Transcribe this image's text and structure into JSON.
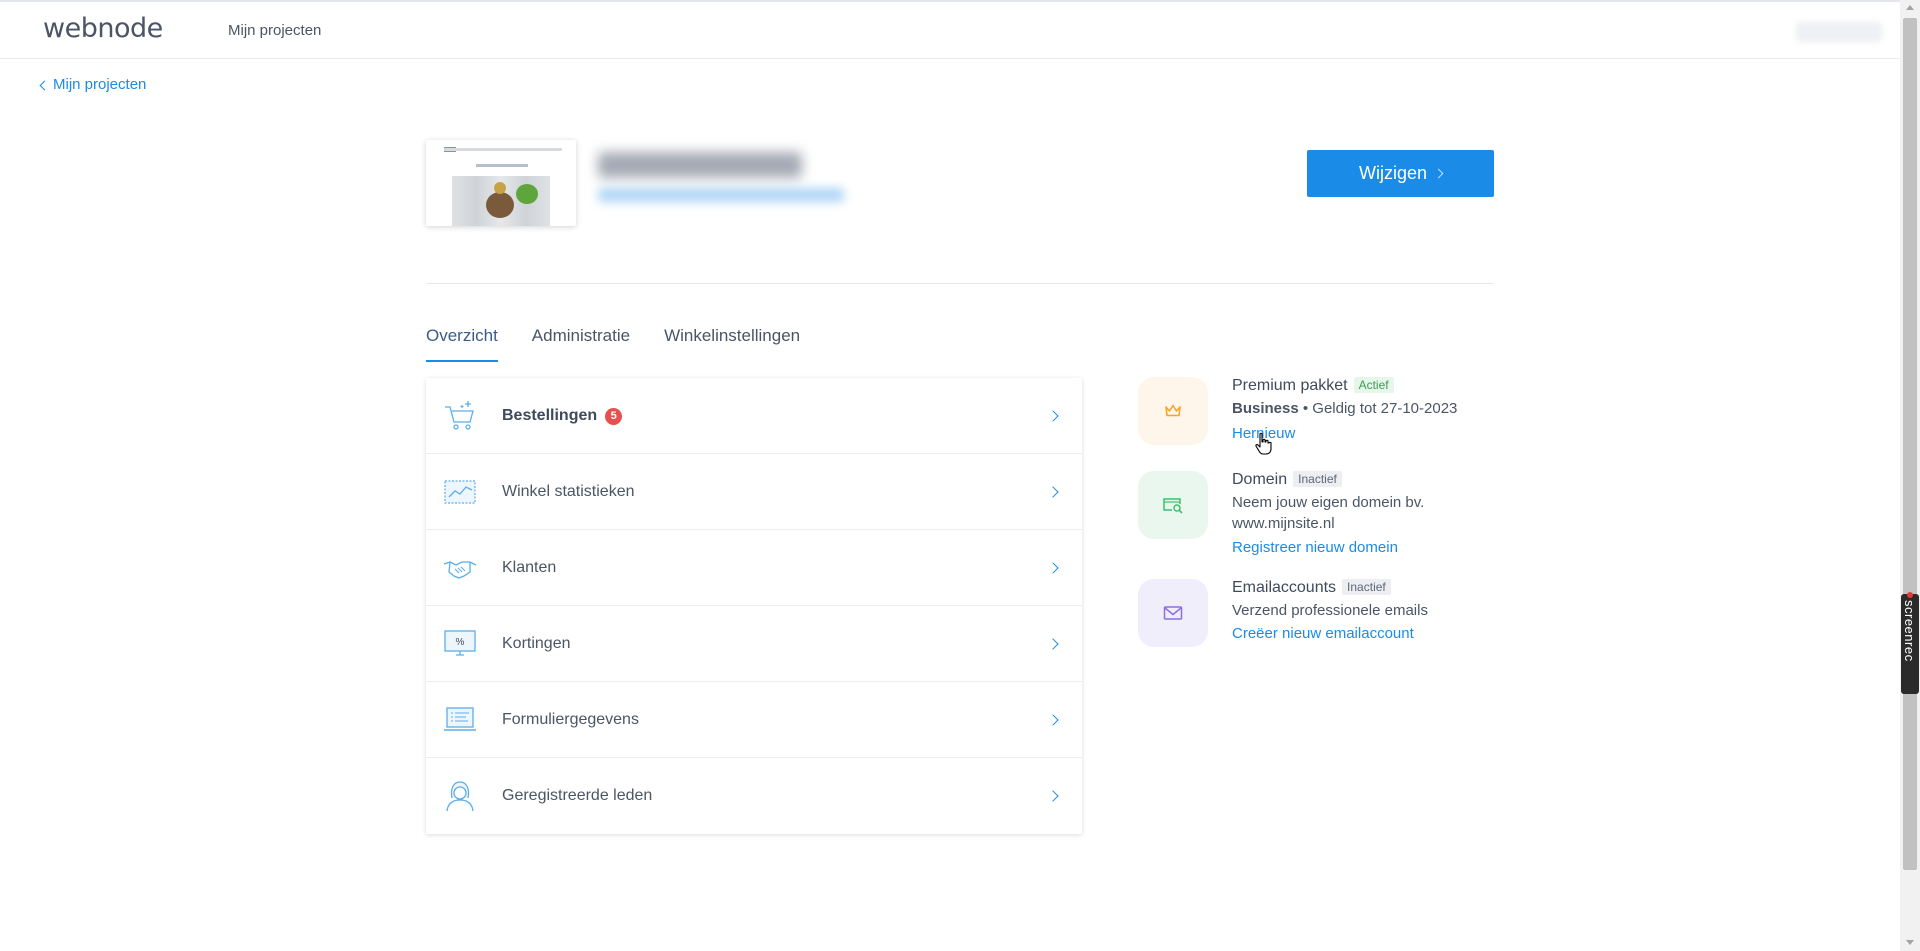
{
  "header": {
    "logo": "webnode",
    "nav_projects": "Mijn projecten"
  },
  "back_link": "Mijn projecten",
  "project": {
    "edit_label": "Wijzigen"
  },
  "tabs": [
    {
      "label": "Overzicht",
      "active": true
    },
    {
      "label": "Administratie",
      "active": false
    },
    {
      "label": "Winkelinstellingen",
      "active": false
    }
  ],
  "menu": [
    {
      "label": "Bestellingen",
      "badge": "5",
      "icon": "cart-icon"
    },
    {
      "label": "Winkel statistieken",
      "icon": "statistics-chart-icon"
    },
    {
      "label": "Klanten",
      "icon": "handshake-icon"
    },
    {
      "label": "Kortingen",
      "icon": "discount-monitor-icon"
    },
    {
      "label": "Formuliergegevens",
      "icon": "form-laptop-icon"
    },
    {
      "label": "Geregistreerde leden",
      "icon": "member-person-icon"
    }
  ],
  "services": {
    "premium": {
      "title": "Premium pakket",
      "status": "Actief",
      "plan": "Business",
      "validity": " • Geldig tot 27-10-2023",
      "link": "Hernieuw",
      "icon": "crown-icon",
      "color": "#f5a623"
    },
    "domain": {
      "title": "Domein",
      "status": "Inactief",
      "description": "Neem jouw eigen domein bv. www.mijnsite.nl",
      "link": "Registreer nieuw domein",
      "icon": "domain-search-icon",
      "color": "#3ebf6e"
    },
    "email": {
      "title": "Emailaccounts",
      "status": "Inactief",
      "description": "Verzend professionele emails",
      "link": "Creëer nieuw emailaccount",
      "icon": "envelope-icon",
      "color": "#8c6fe0"
    }
  },
  "screenrec": {
    "label": "screenrec"
  },
  "colors": {
    "accent": "#1b8be8",
    "badge_red": "#e94f4f"
  }
}
